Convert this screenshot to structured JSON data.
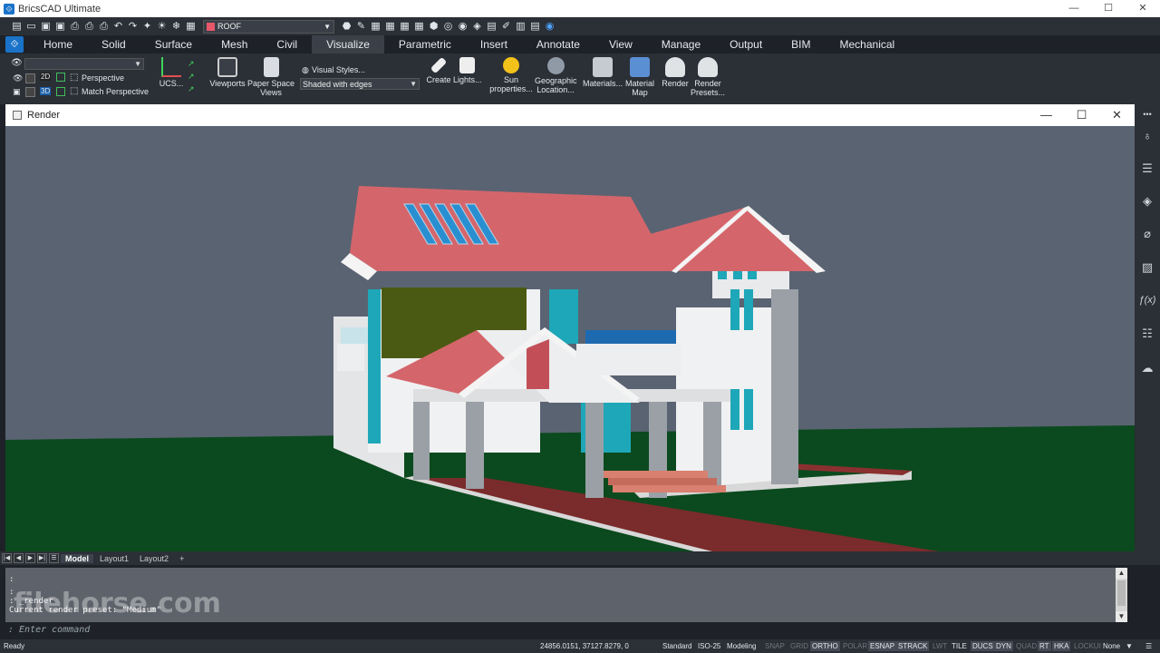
{
  "app": {
    "title": "BricsCAD Ultimate",
    "window_buttons": [
      "—",
      "☐",
      "✕"
    ]
  },
  "quick_access": {
    "layer_name": "ROOF",
    "layer_color": "#e8576a"
  },
  "ribbon_tabs": [
    "Home",
    "Solid",
    "Surface",
    "Mesh",
    "Civil",
    "Visualize",
    "Parametric",
    "Insert",
    "Annotate",
    "View",
    "Manage",
    "Output",
    "BIM",
    "Mechanical"
  ],
  "active_tab": "Visualize",
  "ribbon": {
    "view_dropdown_value": "",
    "perspective_label": "Perspective",
    "match_perspective_label": "Match Perspective",
    "ucs_label": "UCS...",
    "viewports_label": "Viewports",
    "paper_space_views_label": "Paper Space Views",
    "visual_styles_label": "Visual Styles...",
    "visual_style_value": "Shaded with edges",
    "create_label": "Create",
    "lights_label": "Lights...",
    "sun_properties_label": "Sun properties...",
    "geographic_location_label": "Geographic Location...",
    "materials_label": "Materials...",
    "material_map_label": "Material Map",
    "render_label": "Render",
    "render_presets_label": "Render Presets..."
  },
  "render_window": {
    "title": "Render",
    "buttons": [
      "—",
      "☐",
      "✕"
    ]
  },
  "layout_tabs": [
    "Model",
    "Layout1",
    "Layout2"
  ],
  "active_layout": "Model",
  "layout_add": "+",
  "command_history": [
    ":",
    ":",
    ": _render",
    "Current render preset: \"Medium\""
  ],
  "command_prompt": ": Enter command",
  "watermark": "filehorse.com",
  "status": {
    "ready": "Ready",
    "coords": "24856.0151, 37127.8279, 0",
    "items": [
      {
        "label": "Standard",
        "state": "plain"
      },
      {
        "label": "ISO-25",
        "state": "plain"
      },
      {
        "label": "Modeling",
        "state": "plain"
      },
      {
        "label": "SNAP",
        "state": "off"
      },
      {
        "label": "GRID",
        "state": "off"
      },
      {
        "label": "ORTHO",
        "state": "on"
      },
      {
        "label": "POLAR",
        "state": "off"
      },
      {
        "label": "ESNAP",
        "state": "on"
      },
      {
        "label": "STRACK",
        "state": "on"
      },
      {
        "label": "LWT",
        "state": "off"
      },
      {
        "label": "TILE",
        "state": "plain"
      },
      {
        "label": "DUCS",
        "state": "on"
      },
      {
        "label": "DYN",
        "state": "on"
      },
      {
        "label": "QUAD",
        "state": "off"
      },
      {
        "label": "RT",
        "state": "on"
      },
      {
        "label": "HKA",
        "state": "on"
      },
      {
        "label": "LOCKUI",
        "state": "off"
      },
      {
        "label": "None",
        "state": "plain"
      }
    ]
  },
  "colors": {
    "roof": "#d4666b",
    "wall": "#eceeef",
    "ground": "#0b4a1e",
    "sky": "#5a6372",
    "window_glass": "#1ea7b8",
    "accent_green": "#4b5a12",
    "path": "#7a2b2b"
  }
}
